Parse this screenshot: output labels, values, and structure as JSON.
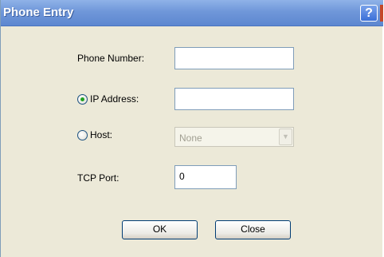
{
  "window": {
    "title": "Phone Entry",
    "help_label": "?"
  },
  "form": {
    "phone_number_label": "Phone Number:",
    "phone_number_value": "",
    "ip_address_label": "IP Address:",
    "ip_address_value": "",
    "ip_selected": true,
    "host_label": "Host:",
    "host_selected": false,
    "host_value": "None",
    "tcp_port_label": "TCP Port:",
    "tcp_port_value": "0"
  },
  "buttons": {
    "ok_label": "OK",
    "close_label": "Close"
  },
  "colors": {
    "titlebar": "#6f97d9",
    "radio_selected": "#21a121",
    "window_bg": "#ece9d8"
  }
}
